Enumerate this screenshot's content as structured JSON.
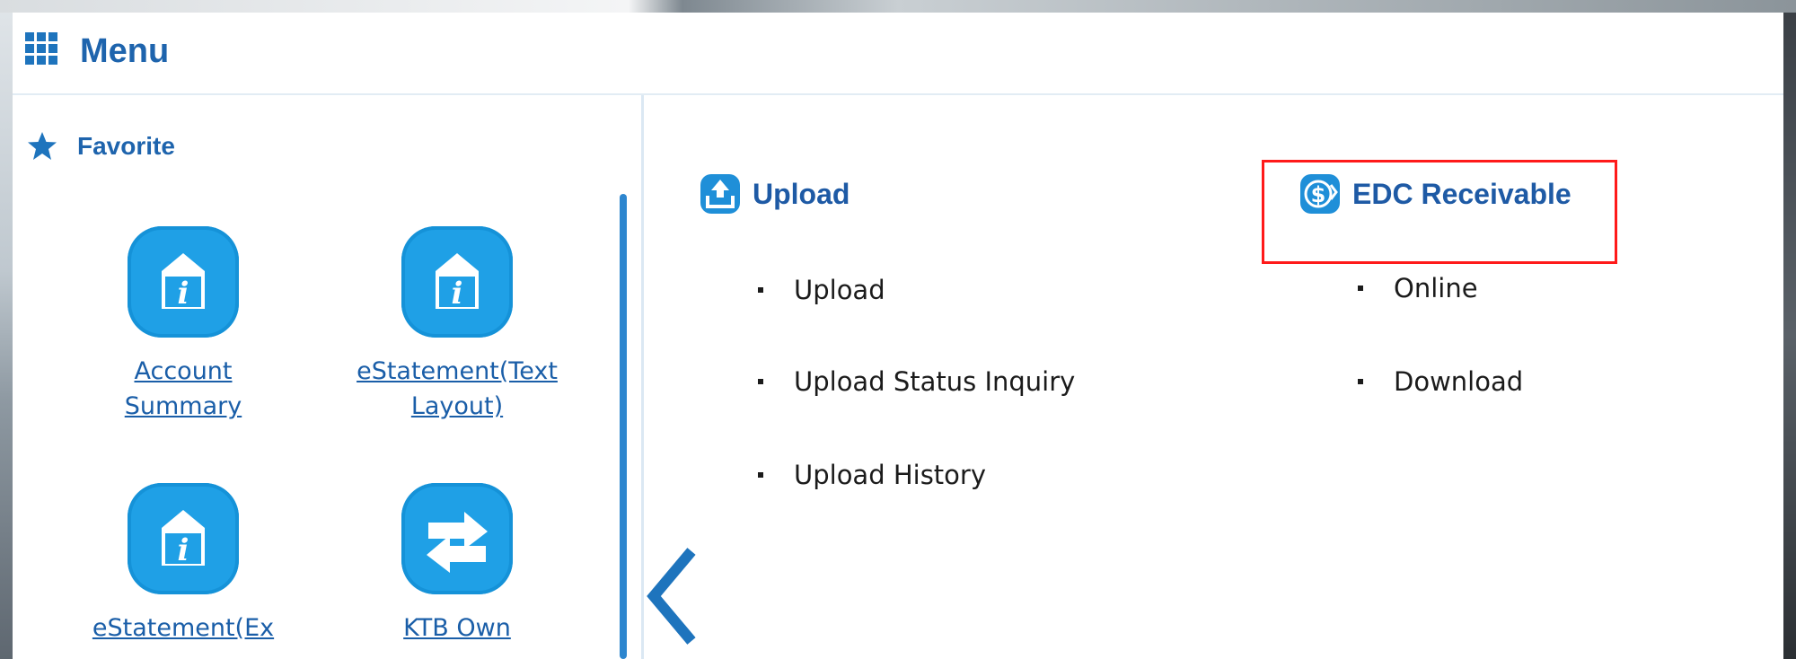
{
  "header": {
    "title": "Menu",
    "icon": "grid-menu-icon"
  },
  "sidebar": {
    "section_label": "Favorite",
    "section_icon": "star-icon",
    "items": [
      {
        "label": "Account Summary",
        "icon": "info-folder-icon"
      },
      {
        "label": "eStatement(Text Layout)",
        "icon": "info-folder-icon"
      },
      {
        "label": "eStatement(Ex",
        "icon": "info-folder-icon"
      },
      {
        "label": "KTB Own",
        "icon": "transfer-arrows-icon"
      }
    ]
  },
  "main": {
    "sections": [
      {
        "title": "Upload",
        "icon": "upload-icon",
        "links": [
          "Upload",
          "Upload Status Inquiry",
          "Upload History"
        ]
      },
      {
        "title": "EDC Receivable",
        "icon": "dollar-icon",
        "links": [
          "Online",
          "Download"
        ],
        "highlighted_link": "Online"
      }
    ]
  },
  "colors": {
    "accent": "#1e64ad",
    "icon_fill": "#1fa0e6",
    "highlight_box": "#ff1a1a"
  }
}
